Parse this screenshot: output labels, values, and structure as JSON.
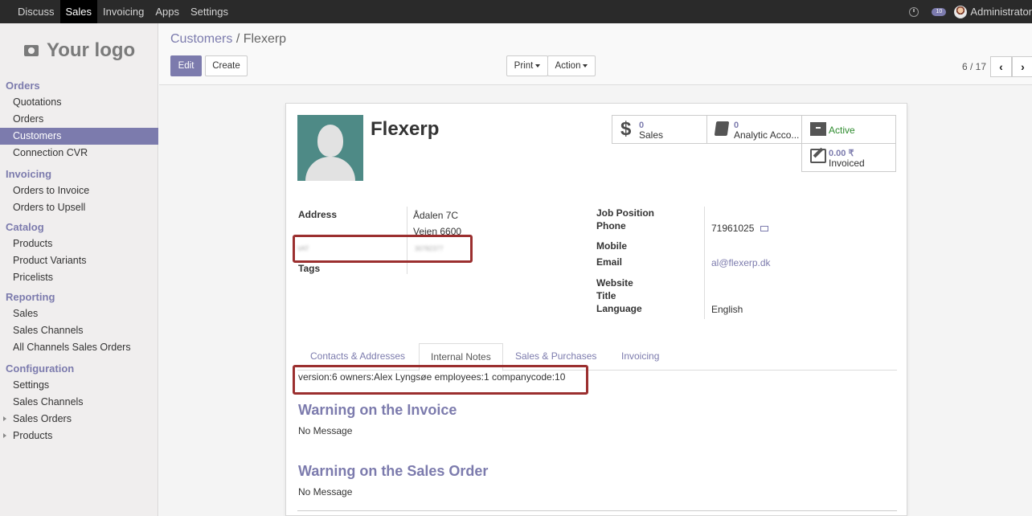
{
  "topbar": {
    "menu": [
      "Discuss",
      "Sales",
      "Invoicing",
      "Apps",
      "Settings"
    ],
    "active_menu": "Sales",
    "chat_count": "10",
    "user": "Administrator"
  },
  "sidebar": {
    "logo_text": "Your logo",
    "sections": [
      {
        "title": "Orders",
        "items": [
          {
            "label": "Quotations"
          },
          {
            "label": "Orders"
          },
          {
            "label": "Customers",
            "active": true
          },
          {
            "label": "Connection CVR"
          }
        ]
      },
      {
        "title": "Invoicing",
        "items": [
          {
            "label": "Orders to Invoice"
          },
          {
            "label": "Orders to Upsell"
          }
        ]
      },
      {
        "title": "Catalog",
        "items": [
          {
            "label": "Products"
          },
          {
            "label": "Product Variants"
          },
          {
            "label": "Pricelists"
          }
        ]
      },
      {
        "title": "Reporting",
        "items": [
          {
            "label": "Sales"
          },
          {
            "label": "Sales Channels"
          },
          {
            "label": "All Channels Sales Orders"
          }
        ]
      },
      {
        "title": "Configuration",
        "items": [
          {
            "label": "Settings"
          },
          {
            "label": "Sales Channels"
          },
          {
            "label": "Sales Orders",
            "caret": true
          },
          {
            "label": "Products",
            "caret": true
          }
        ]
      }
    ]
  },
  "breadcrumb": {
    "parent": "Customers",
    "separator": "/",
    "current": "Flexerp"
  },
  "buttons": {
    "edit": "Edit",
    "create": "Create",
    "print": "Print",
    "action": "Action"
  },
  "pager": {
    "value": "6 / 17"
  },
  "partner": {
    "name": "Flexerp",
    "smart_buttons": {
      "sales_value": "0",
      "sales_label": "Sales",
      "analytic_value": "0",
      "analytic_label": "Analytic Acco...",
      "active_label": "Active",
      "invoiced_value": "0.00 ₹",
      "invoiced_label": "Invoiced"
    },
    "fields": {
      "address_label": "Address",
      "address_line1": "Ådalen 7C",
      "address_line2": "Vejen 6600",
      "redacted_label": "VAT",
      "redacted_value": "30782377",
      "tags_label": "Tags",
      "job_position_label": "Job Position",
      "phone_label": "Phone",
      "phone_value": "71961025",
      "mobile_label": "Mobile",
      "email_label": "Email",
      "email_value": "al@flexerp.dk",
      "website_label": "Website",
      "title_label": "Title",
      "language_label": "Language",
      "language_value": "English"
    }
  },
  "tabs": [
    "Contacts & Addresses",
    "Internal Notes",
    "Sales & Purchases",
    "Invoicing"
  ],
  "active_tab": "Internal Notes",
  "internal_notes": "version:6  owners:Alex Lyngsøe  employees:1  companycode:10",
  "warnings": {
    "invoice_title": "Warning on the Invoice",
    "invoice_msg": "No Message",
    "sales_title": "Warning on the Sales Order",
    "sales_msg": "No Message"
  }
}
